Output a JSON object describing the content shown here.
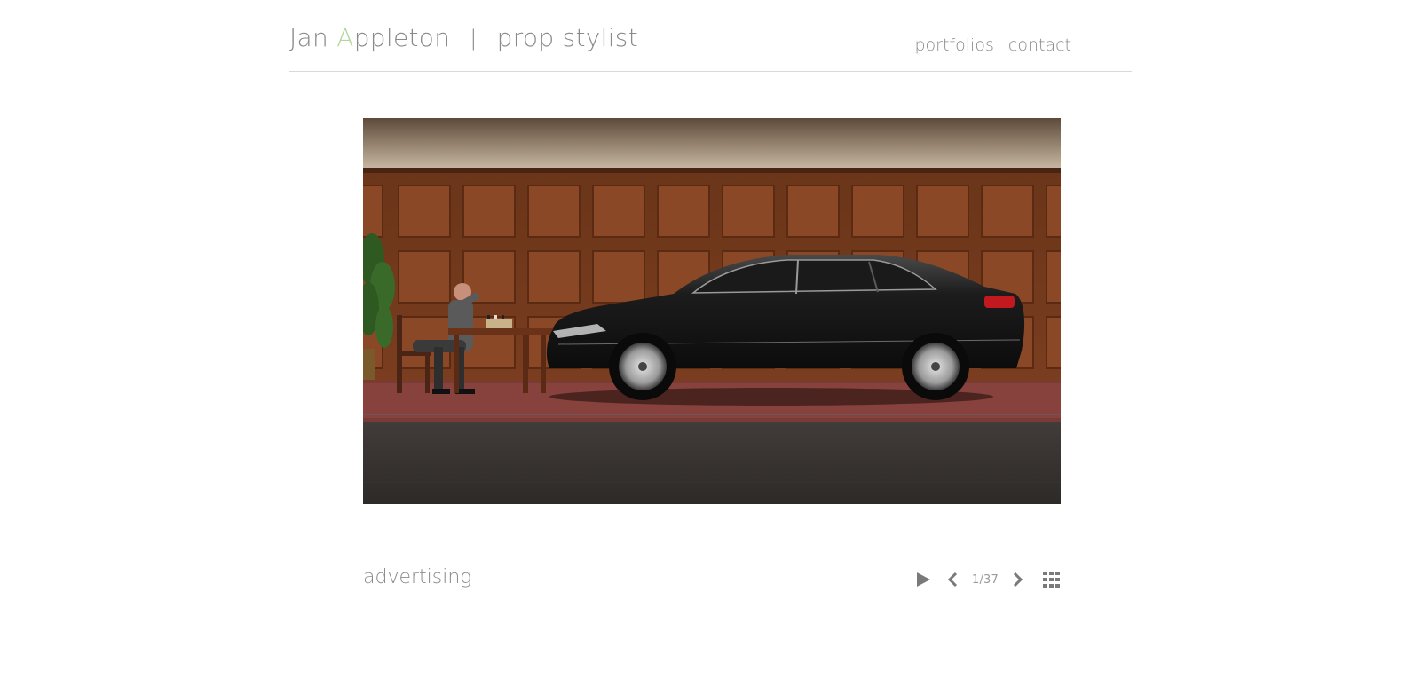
{
  "header": {
    "title_first": "Jan ",
    "title_accent_letter": "A",
    "title_rest": "ppleton",
    "separator": "|",
    "subtitle": "prop stylist",
    "accent_color": "#b2d79b"
  },
  "nav": {
    "items": [
      {
        "label": "portfolios"
      },
      {
        "label": "contact"
      }
    ]
  },
  "gallery": {
    "caption": "advertising",
    "counter": "1/37",
    "controls": {
      "play_icon": "play-icon",
      "prev_icon": "chevron-left-icon",
      "next_icon": "chevron-right-icon",
      "grid_icon": "grid-icon"
    }
  }
}
